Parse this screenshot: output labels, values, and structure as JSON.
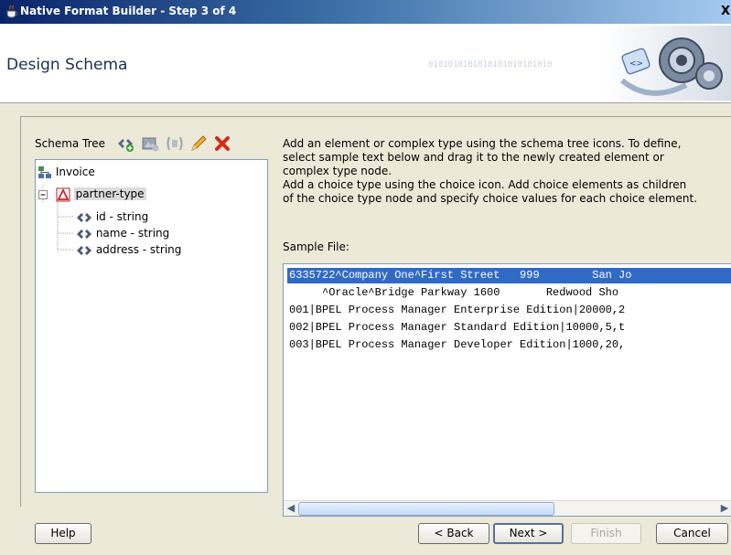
{
  "window": {
    "title": "Native Format Builder - Step 3 of 4",
    "close_glyph": "X"
  },
  "header": {
    "title": "Design Schema",
    "binary_text": "0101010101010101010101010"
  },
  "schema_tree": {
    "label": "Schema Tree",
    "toolbar_icons": [
      "add-element-icon",
      "add-complex-type-icon",
      "add-choice-icon",
      "edit-icon",
      "delete-icon"
    ],
    "nodes": [
      {
        "label": "Invoice",
        "icon": "schema-root-icon"
      },
      {
        "label": "partner-type",
        "icon": "complex-type-icon",
        "selected": true
      },
      {
        "label": "id - string",
        "icon": "element-icon"
      },
      {
        "label": "name - string",
        "icon": "element-icon"
      },
      {
        "label": "address - string",
        "icon": "element-icon"
      }
    ]
  },
  "instructions": {
    "line1": "Add an element or complex type using the schema tree icons. To define,",
    "line2": "select sample text below and drag it to the newly created element or",
    "line3": "complex type node.",
    "line4": "Add a choice type using the choice icon. Add choice elements as children",
    "line5": "of the choice type node and specify choice values for each choice element."
  },
  "sample_file": {
    "label": "Sample File:",
    "lines": [
      "6335722^Company One^First Street   999        San Jo",
      "     ^Oracle^Bridge Parkway 1600       Redwood Sho",
      "001|BPEL Process Manager Enterprise Edition|20000,2",
      "002|BPEL Process Manager Standard Edition|10000,5,t",
      "003|BPEL Process Manager Developer Edition|1000,20,"
    ]
  },
  "buttons": {
    "help": "Help",
    "back": "< Back",
    "next": "Next >",
    "finish": "Finish",
    "cancel": "Cancel"
  }
}
